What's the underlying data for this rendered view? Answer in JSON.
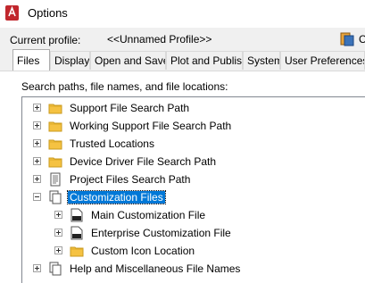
{
  "window": {
    "title": "Options"
  },
  "profile": {
    "label": "Current profile:",
    "value": "<<Unnamed Profile>>",
    "cut_text": "C"
  },
  "tabs": [
    "Files",
    "Display",
    "Open and Save",
    "Plot and Publish",
    "System",
    "User Preferences"
  ],
  "panel": {
    "label": "Search paths, file names, and file locations:"
  },
  "tree": {
    "items": [
      {
        "label": "Support File Search Path",
        "icon": "folder-icon"
      },
      {
        "label": "Working Support File Search Path",
        "icon": "folder-icon"
      },
      {
        "label": "Trusted Locations",
        "icon": "folder-icon"
      },
      {
        "label": "Device Driver File Search Path",
        "icon": "folder-icon"
      },
      {
        "label": "Project Files Search Path",
        "icon": "document-icon"
      },
      {
        "label": "Customization Files",
        "icon": "files-icon",
        "selected": true
      },
      {
        "label": "Main Customization File",
        "icon": "cui-file-icon"
      },
      {
        "label": "Enterprise Customization File",
        "icon": "cui-file-icon"
      },
      {
        "label": "Custom Icon Location",
        "icon": "folder-icon"
      },
      {
        "label": "Help and Miscellaneous File Names",
        "icon": "files-icon"
      }
    ]
  },
  "colors": {
    "selection": "#0078d7",
    "folder": "#f5c242",
    "app_icon": "#c1272d"
  }
}
